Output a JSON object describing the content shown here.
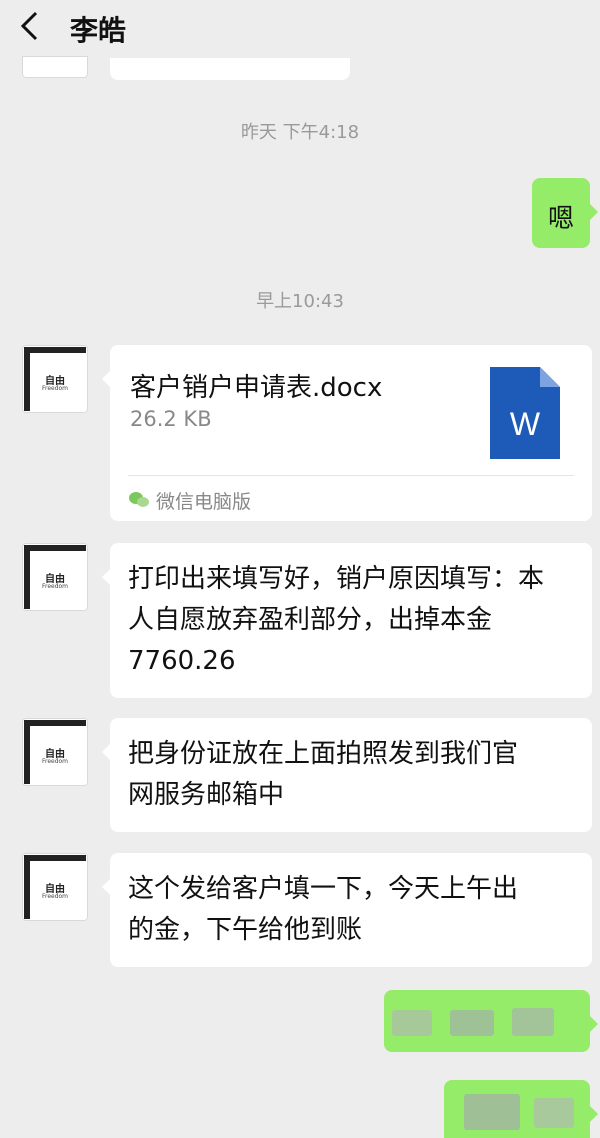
{
  "header": {
    "title": "李皓",
    "back_icon": "chevron-left-icon"
  },
  "timestamps": {
    "t1": "昨天 下午4:18",
    "t2": "早上10:43"
  },
  "avatar": {
    "logo_cn": "自由",
    "logo_en": "Freedom"
  },
  "messages": {
    "reply_1": "嗯",
    "file": {
      "name": "客户销户申请表.docx",
      "size": "26.2 KB",
      "source": "微信电脑版",
      "icon": "word-doc-icon",
      "icon_letter": "W"
    },
    "msg_1_line1": "打印出来填写好，销户原因填写：本",
    "msg_1_line2": "人自愿放弃盈利部分，出掉本金",
    "msg_1_line3": "7760.26",
    "msg_2_line1": "把身份证放在上面拍照发到我们官",
    "msg_2_line2": "网服务邮箱中",
    "msg_3_line1": "这个发给客户填一下，今天上午出",
    "msg_3_line2": "的金，下午给他到账"
  },
  "colors": {
    "background": "#ededed",
    "bubble_self": "#95ec69",
    "bubble_other": "#ffffff",
    "word_blue": "#1e5bb8"
  }
}
